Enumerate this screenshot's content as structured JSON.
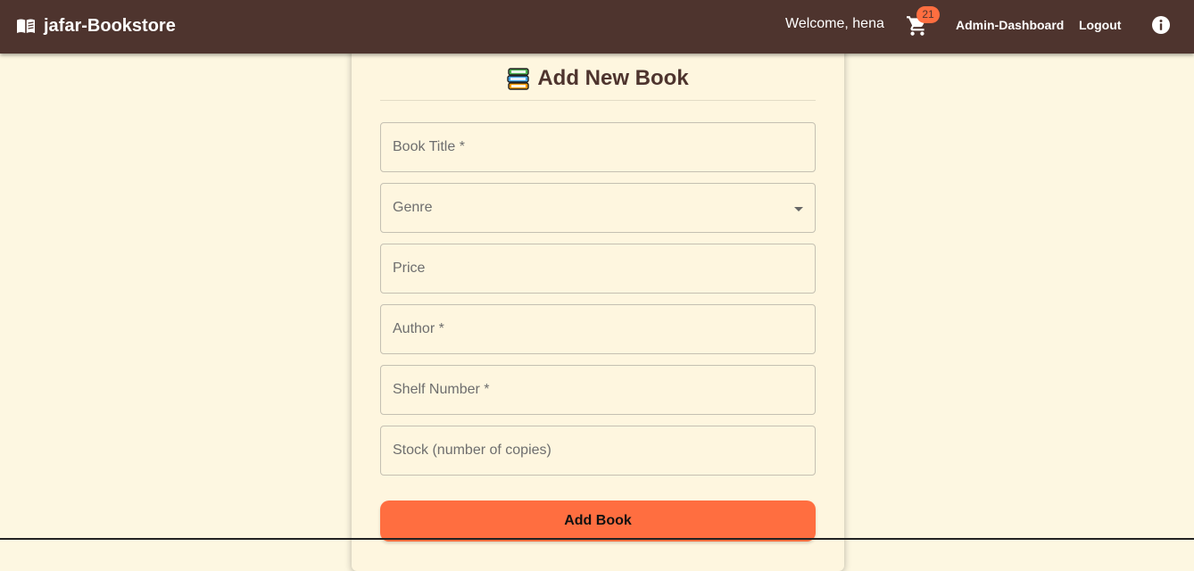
{
  "app": {
    "brand": "jafar-Bookstore",
    "welcome": "Welcome, hena",
    "cart_count": "21",
    "nav": {
      "admin_dashboard": "Admin-Dashboard",
      "logout": "Logout"
    }
  },
  "form": {
    "title": "Add New Book",
    "fields": [
      {
        "label": "Book Title *",
        "type": "text"
      },
      {
        "label": "Genre",
        "type": "select"
      },
      {
        "label": "Price",
        "type": "text"
      },
      {
        "label": "Author *",
        "type": "text"
      },
      {
        "label": "Shelf Number *",
        "type": "text"
      },
      {
        "label": "Stock (number of copies)",
        "type": "text"
      }
    ],
    "submit_label": "Add Book"
  },
  "colors": {
    "appbar": "#4e342e",
    "background": "#fdf7e1",
    "accent": "#ff6e40"
  },
  "icons": {
    "brand": "open-book-icon",
    "cart": "shopping-cart-icon",
    "info": "info-icon",
    "title": "books-stack-icon",
    "select": "chevron-down-icon"
  }
}
